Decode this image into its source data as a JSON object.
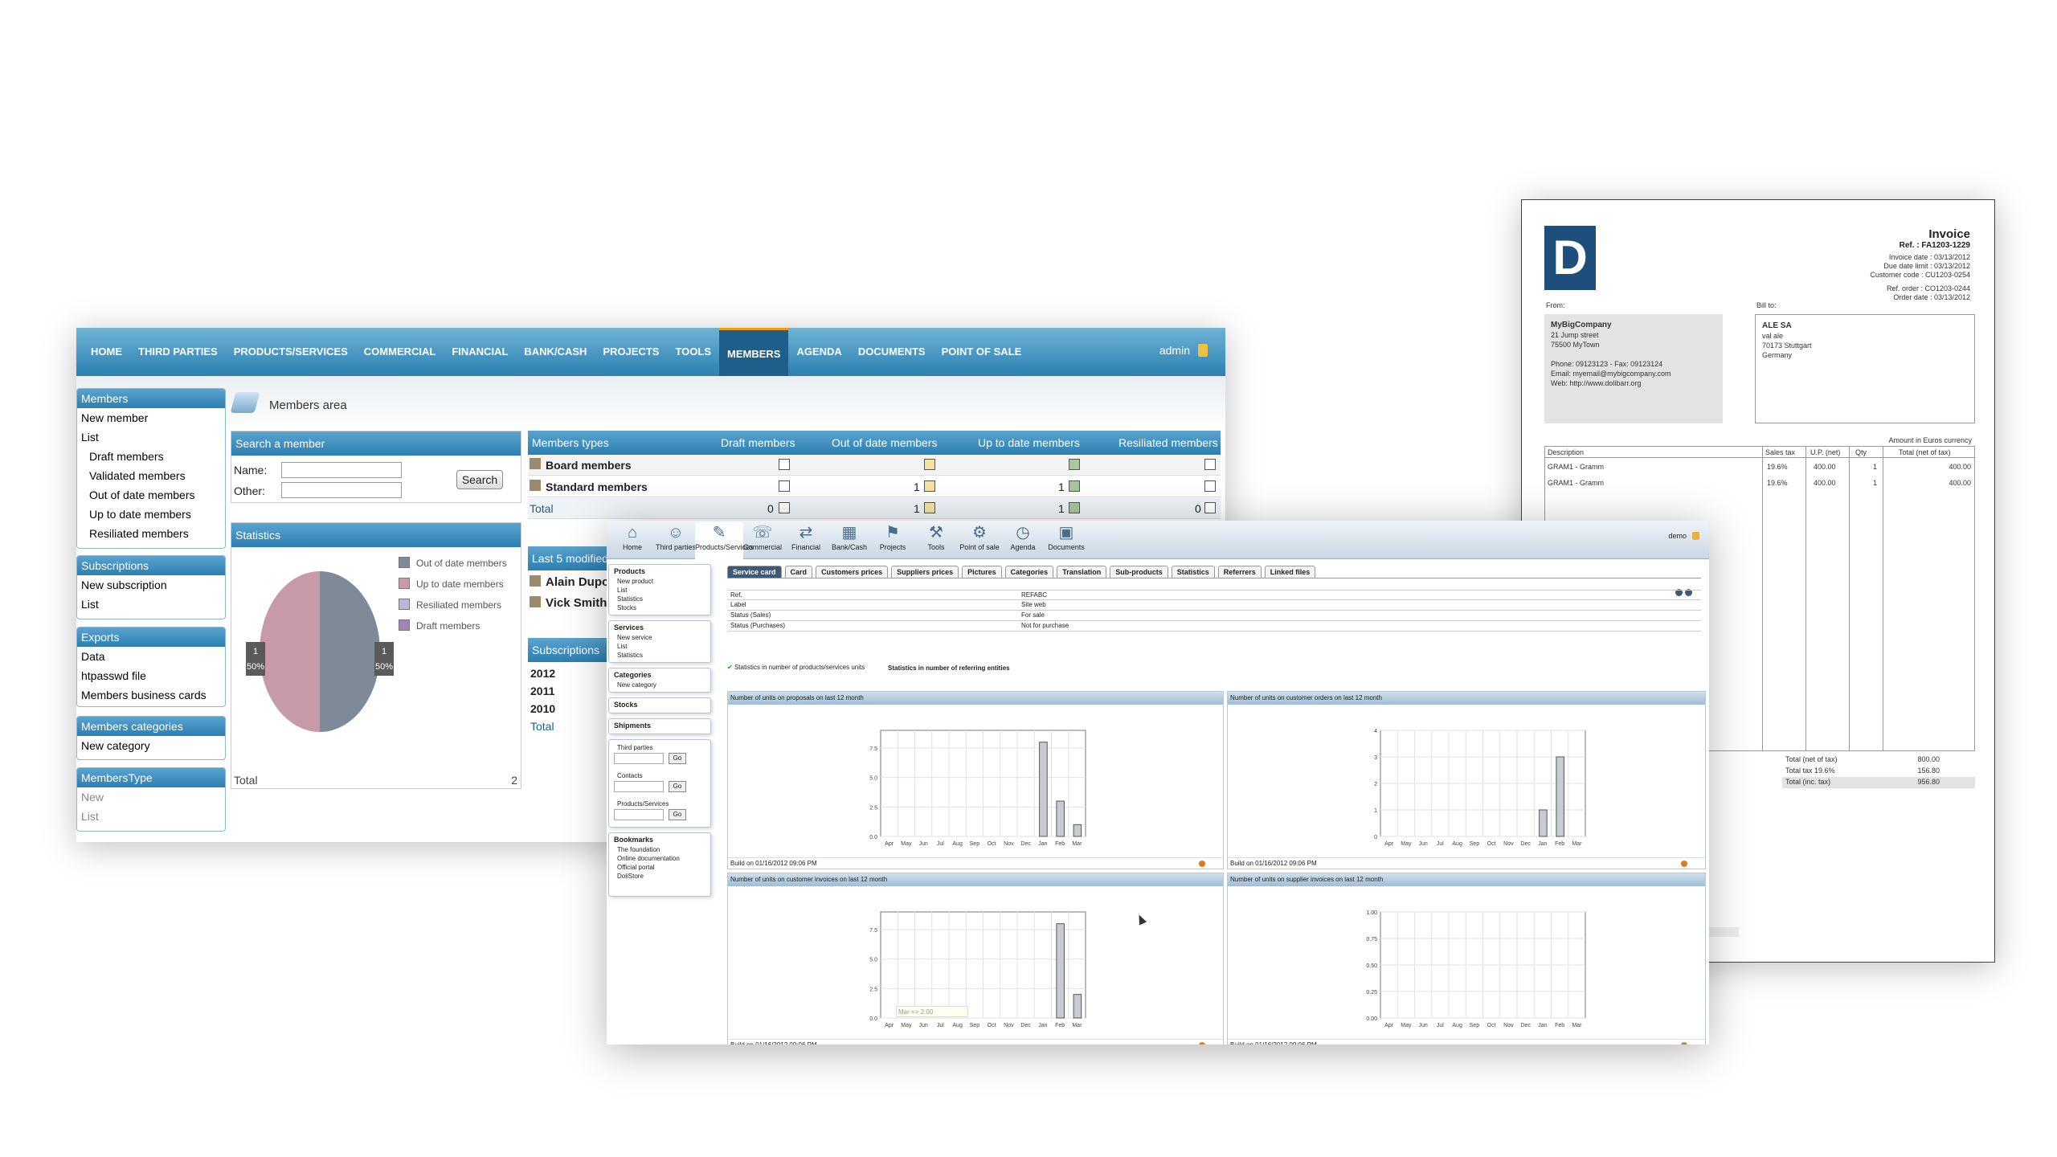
{
  "members_window": {
    "nav": [
      "HOME",
      "THIRD PARTIES",
      "PRODUCTS/SERVICES",
      "COMMERCIAL",
      "FINANCIAL",
      "BANK/CASH",
      "PROJECTS",
      "TOOLS",
      "MEMBERS",
      "AGENDA",
      "DOCUMENTS",
      "POINT OF SALE"
    ],
    "active_tab": "MEMBERS",
    "user": "admin",
    "area_title": "Members area",
    "sidebar": {
      "members": {
        "title": "Members",
        "items": [
          "New member",
          "List",
          "Draft members",
          "Validated members",
          "Out of date members",
          "Up to date members",
          "Resiliated members"
        ]
      },
      "subscriptions": {
        "title": "Subscriptions",
        "items": [
          "New subscription",
          "List"
        ]
      },
      "exports": {
        "title": "Exports",
        "items": [
          "Data",
          "htpasswd file",
          "Members business cards"
        ]
      },
      "categories": {
        "title": "Members categories",
        "items": [
          "New category"
        ]
      },
      "type": {
        "title": "MembersType",
        "items": [
          "New",
          "List"
        ]
      }
    },
    "search": {
      "title": "Search a member",
      "name_label": "Name:",
      "other_label": "Other:",
      "button": "Search"
    },
    "statistics": {
      "title": "Statistics",
      "legend": [
        "Out of date members",
        "Up to date members",
        "Resiliated members",
        "Draft members"
      ],
      "legend_colors": [
        "#7e8a97",
        "#c79aa7",
        "#b8b7d8",
        "#a184b8"
      ],
      "pie_labels": [
        {
          "count": "1",
          "pct": "50%"
        },
        {
          "count": "1",
          "pct": "50%"
        }
      ],
      "total_label": "Total",
      "total_value": "2"
    },
    "types_table": {
      "headers": [
        "Members types",
        "Draft members",
        "Out of date members",
        "Up to date members",
        "Resiliated members"
      ],
      "rows": [
        {
          "name": "Board members",
          "draft": "",
          "outofdate": "",
          "uptodate": "",
          "resiliated": ""
        },
        {
          "name": "Standard members",
          "draft": "",
          "outofdate": "1",
          "uptodate": "1",
          "resiliated": ""
        }
      ],
      "total": {
        "label": "Total",
        "draft": "0",
        "outofdate": "1",
        "uptodate": "1",
        "resiliated": "0"
      }
    },
    "last_modified": {
      "title": "Last 5 modified",
      "rows": [
        "Alain Dupon",
        "Vick Smith"
      ]
    },
    "subscriptions_table": {
      "title": "Subscriptions",
      "rows": [
        "2012",
        "2011",
        "2010"
      ],
      "total": "Total"
    }
  },
  "invoice_window": {
    "logo": "D",
    "title": "Invoice",
    "ref": "Ref. : FA1203-1229",
    "meta": [
      "Invoice date : 03/13/2012",
      "Due date limit : 03/13/2012",
      "Customer code : CU1203-0254",
      "Ref. order : CO1203-0244",
      "Order date : 03/13/2012"
    ],
    "from_label": "From:",
    "bill_label": "Bill to:",
    "from": [
      "MyBigCompany",
      "21 Jump street",
      "75500 MyTown",
      "",
      "Phone: 09123123 - Fax: 09123124",
      "Email: myemail@mybigcompany.com",
      "Web: http://www.dolibarr.org"
    ],
    "bill": [
      "ALE SA",
      "val ale",
      "70173 Stuttgart",
      "Germany"
    ],
    "currency_note": "Amount in Euros currency",
    "columns": [
      "Description",
      "Sales tax",
      "U.P. (net)",
      "Qty",
      "Total (net of tax)"
    ],
    "lines": [
      {
        "desc": "GRAM1 - Gramm",
        "tax": "19.6%",
        "up": "400.00",
        "qty": "1",
        "total": "400.00"
      },
      {
        "desc": "GRAM1 - Gramm",
        "tax": "19.6%",
        "up": "400.00",
        "qty": "1",
        "total": "400.00"
      }
    ],
    "totals": [
      {
        "label": "Total (net of tax)",
        "value": "800.00"
      },
      {
        "label": "Total tax 19.6%",
        "value": "156.80"
      },
      {
        "label": "Total (inc. tax)",
        "value": "956.80"
      }
    ]
  },
  "products_window": {
    "toolbar": [
      "Home",
      "Third parties",
      "Products/Services",
      "Commercial",
      "Financial",
      "Bank/Cash",
      "Projects",
      "Tools",
      "Point of sale",
      "Agenda",
      "Documents"
    ],
    "toolbar_icons": [
      "home-icon",
      "third-parties-icon",
      "products-icon",
      "commercial-icon",
      "financial-icon",
      "bank-icon",
      "projects-icon",
      "tools-icon",
      "point-of-sale-icon",
      "agenda-icon",
      "documents-icon"
    ],
    "user": "demo",
    "left_menu": [
      {
        "title": "Products",
        "items": [
          "New product",
          "List",
          "Statistics",
          "Stocks"
        ]
      },
      {
        "title": "Services",
        "items": [
          "New service",
          "List",
          "Statistics"
        ]
      },
      {
        "title": "Categories",
        "items": [
          "New category"
        ]
      },
      {
        "title": "Stocks",
        "items": []
      },
      {
        "title": "Shipments",
        "items": []
      }
    ],
    "quick_search": [
      "Third parties",
      "Contacts",
      "Products/Services"
    ],
    "go_label": "Go",
    "bookmarks": {
      "title": "Bookmarks",
      "items": [
        "The foundation",
        "Online documentation",
        "Official portal",
        "DoliStore"
      ]
    },
    "tabs": [
      "Service card",
      "Card",
      "Customers prices",
      "Suppliers prices",
      "Pictures",
      "Categories",
      "Translation",
      "Sub-products",
      "Statistics",
      "Referrers",
      "Linked files"
    ],
    "active_tab": "Service card",
    "fields": [
      {
        "k": "Ref.",
        "v": "REFABC"
      },
      {
        "k": "Label",
        "v": "Site web"
      },
      {
        "k": "Status (Sales)",
        "v": "For sale"
      },
      {
        "k": "Status (Purchases)",
        "v": "Not for purchase"
      }
    ],
    "stat_links": [
      "Statistics in number of products/services units",
      "Statistics in number of referring entities"
    ],
    "build_label": "Build on 01/16/2012 09:06 PM",
    "tooltip": "Mar => 2.00"
  },
  "chart_data": [
    {
      "type": "bar",
      "title": "Number of units on proposals on last 12 month",
      "categories": [
        "Apr",
        "May",
        "Jun",
        "Jul",
        "Aug",
        "Sep",
        "Oct",
        "Nov",
        "Dec",
        "Jan",
        "Feb",
        "Mar"
      ],
      "values": [
        0,
        0,
        0,
        0,
        0,
        0,
        0,
        0,
        0,
        8,
        3,
        1
      ],
      "yticks": [
        "0.0",
        "2.5",
        "5.0",
        "7.5"
      ],
      "ylim": [
        0,
        9
      ]
    },
    {
      "type": "bar",
      "title": "Number of units on customer orders on last 12 month",
      "categories": [
        "Apr",
        "May",
        "Jun",
        "Jul",
        "Aug",
        "Sep",
        "Oct",
        "Nov",
        "Dec",
        "Jan",
        "Feb",
        "Mar"
      ],
      "values": [
        0,
        0,
        0,
        0,
        0,
        0,
        0,
        0,
        0,
        1,
        3,
        0
      ],
      "yticks": [
        "0",
        "1",
        "2",
        "3",
        "4"
      ],
      "ylim": [
        0,
        4
      ]
    },
    {
      "type": "bar",
      "title": "Number of units on customer invoices on last 12 month",
      "categories": [
        "Apr",
        "May",
        "Jun",
        "Jul",
        "Aug",
        "Sep",
        "Oct",
        "Nov",
        "Dec",
        "Jan",
        "Feb",
        "Mar"
      ],
      "values": [
        0,
        0,
        0,
        0,
        0,
        0,
        0,
        0,
        0,
        0,
        8,
        2
      ],
      "yticks": [
        "0.0",
        "2.5",
        "5.0",
        "7.5"
      ],
      "ylim": [
        0,
        9
      ]
    },
    {
      "type": "bar",
      "title": "Number of units on supplier invoices on last 12 month",
      "categories": [
        "Apr",
        "May",
        "Jun",
        "Jul",
        "Aug",
        "Sep",
        "Oct",
        "Nov",
        "Dec",
        "Jan",
        "Feb",
        "Mar"
      ],
      "values": [
        0,
        0,
        0,
        0,
        0,
        0,
        0,
        0,
        0,
        0,
        0,
        0
      ],
      "yticks": [
        "0.00",
        "0.25",
        "0.50",
        "0.75",
        "1.00"
      ],
      "ylim": [
        0,
        1
      ]
    }
  ]
}
